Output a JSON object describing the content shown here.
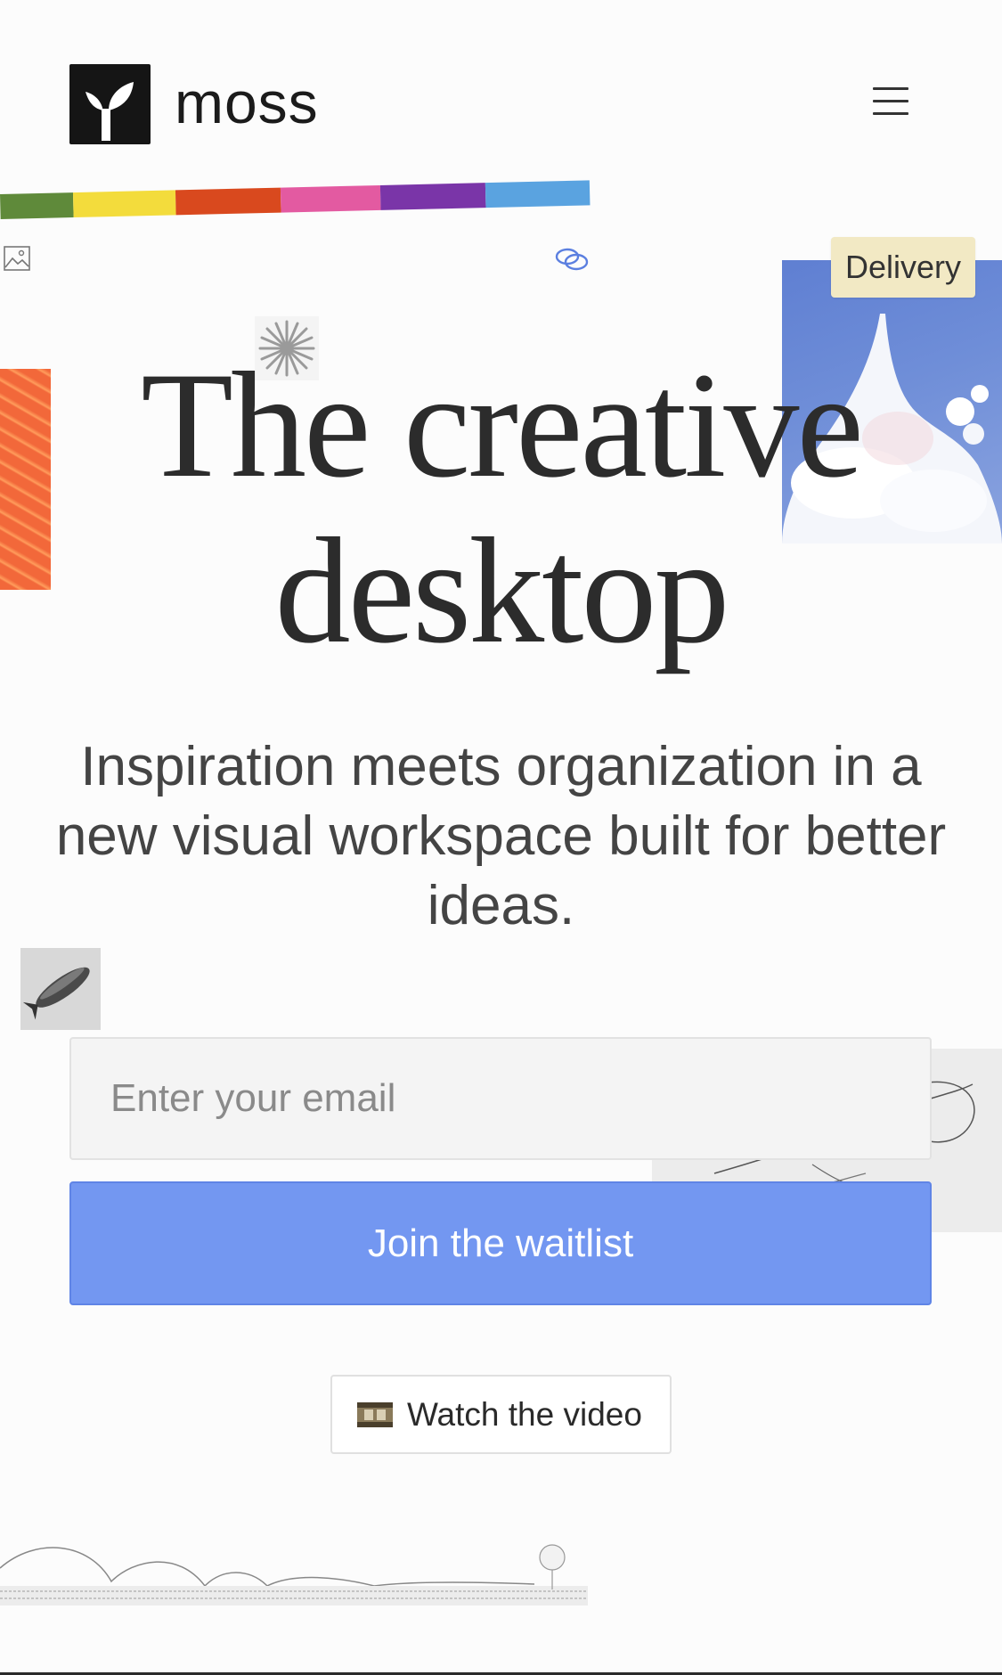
{
  "header": {
    "logo_word": "moss",
    "logo_icon": "sprout-icon",
    "menu_icon": "hamburger-menu-icon"
  },
  "color_strip": [
    "#5f8a3a",
    "#f3dc3c",
    "#d9491e",
    "#e35aa1",
    "#7a35a8",
    "#5aa3e0"
  ],
  "decor": {
    "delivery_tag": "Delivery",
    "image_icon": "image-placeholder-icon",
    "link_icon": "link-icon"
  },
  "hero": {
    "headline_line1": "The creative",
    "headline_line2": "desktop",
    "subtitle": "Inspiration meets organization in a new visual workspace built for better ideas."
  },
  "form": {
    "email_placeholder": "Enter your email",
    "submit_label": "Join the waitlist"
  },
  "video": {
    "label": "Watch the video",
    "icon": "film-reel-icon"
  },
  "colors": {
    "accent": "#7397f1",
    "text": "#2c2c2c",
    "background": "#fcfcfc"
  }
}
